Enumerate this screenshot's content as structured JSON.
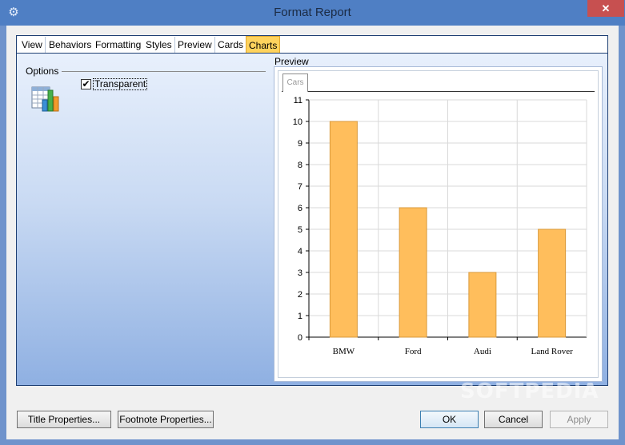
{
  "window": {
    "title": "Format Report",
    "close_glyph": "✕",
    "app_icon": "gear-icon"
  },
  "tabs": [
    {
      "label": "View",
      "active": false
    },
    {
      "label": "Behaviors",
      "active": false
    },
    {
      "label": "Formatting",
      "active": false
    },
    {
      "label": "Styles",
      "active": false
    },
    {
      "label": "Preview",
      "active": false
    },
    {
      "label": "Cards",
      "active": false
    },
    {
      "label": "Charts",
      "active": true
    }
  ],
  "options": {
    "legend": "Options",
    "transparent_label": "Transparent",
    "transparent_checked": true,
    "check_glyph": "✔"
  },
  "preview": {
    "legend": "Preview",
    "tab_label": "Cars"
  },
  "chart_data": {
    "type": "bar",
    "categories": [
      "BMW",
      "Ford",
      "Audi",
      "Land Rover"
    ],
    "values": [
      10,
      6,
      3,
      5
    ],
    "title": "",
    "xlabel": "",
    "ylabel": "",
    "ylim": [
      0,
      11
    ],
    "yticks": [
      0,
      1,
      2,
      3,
      4,
      5,
      6,
      7,
      8,
      9,
      10,
      11
    ],
    "grid": true,
    "bar_color": "#ffbe5c",
    "bar_stroke": "#d99a3c"
  },
  "buttons": {
    "title_properties": "Title Properties...",
    "footnote_properties": "Footnote Properties...",
    "ok": "OK",
    "cancel": "Cancel",
    "apply": "Apply"
  },
  "watermark": "SOFTPEDIA",
  "colors": {
    "titlebar": "#4f7fc4",
    "active_tab": "#ffd35d",
    "close_button": "#c75050"
  }
}
